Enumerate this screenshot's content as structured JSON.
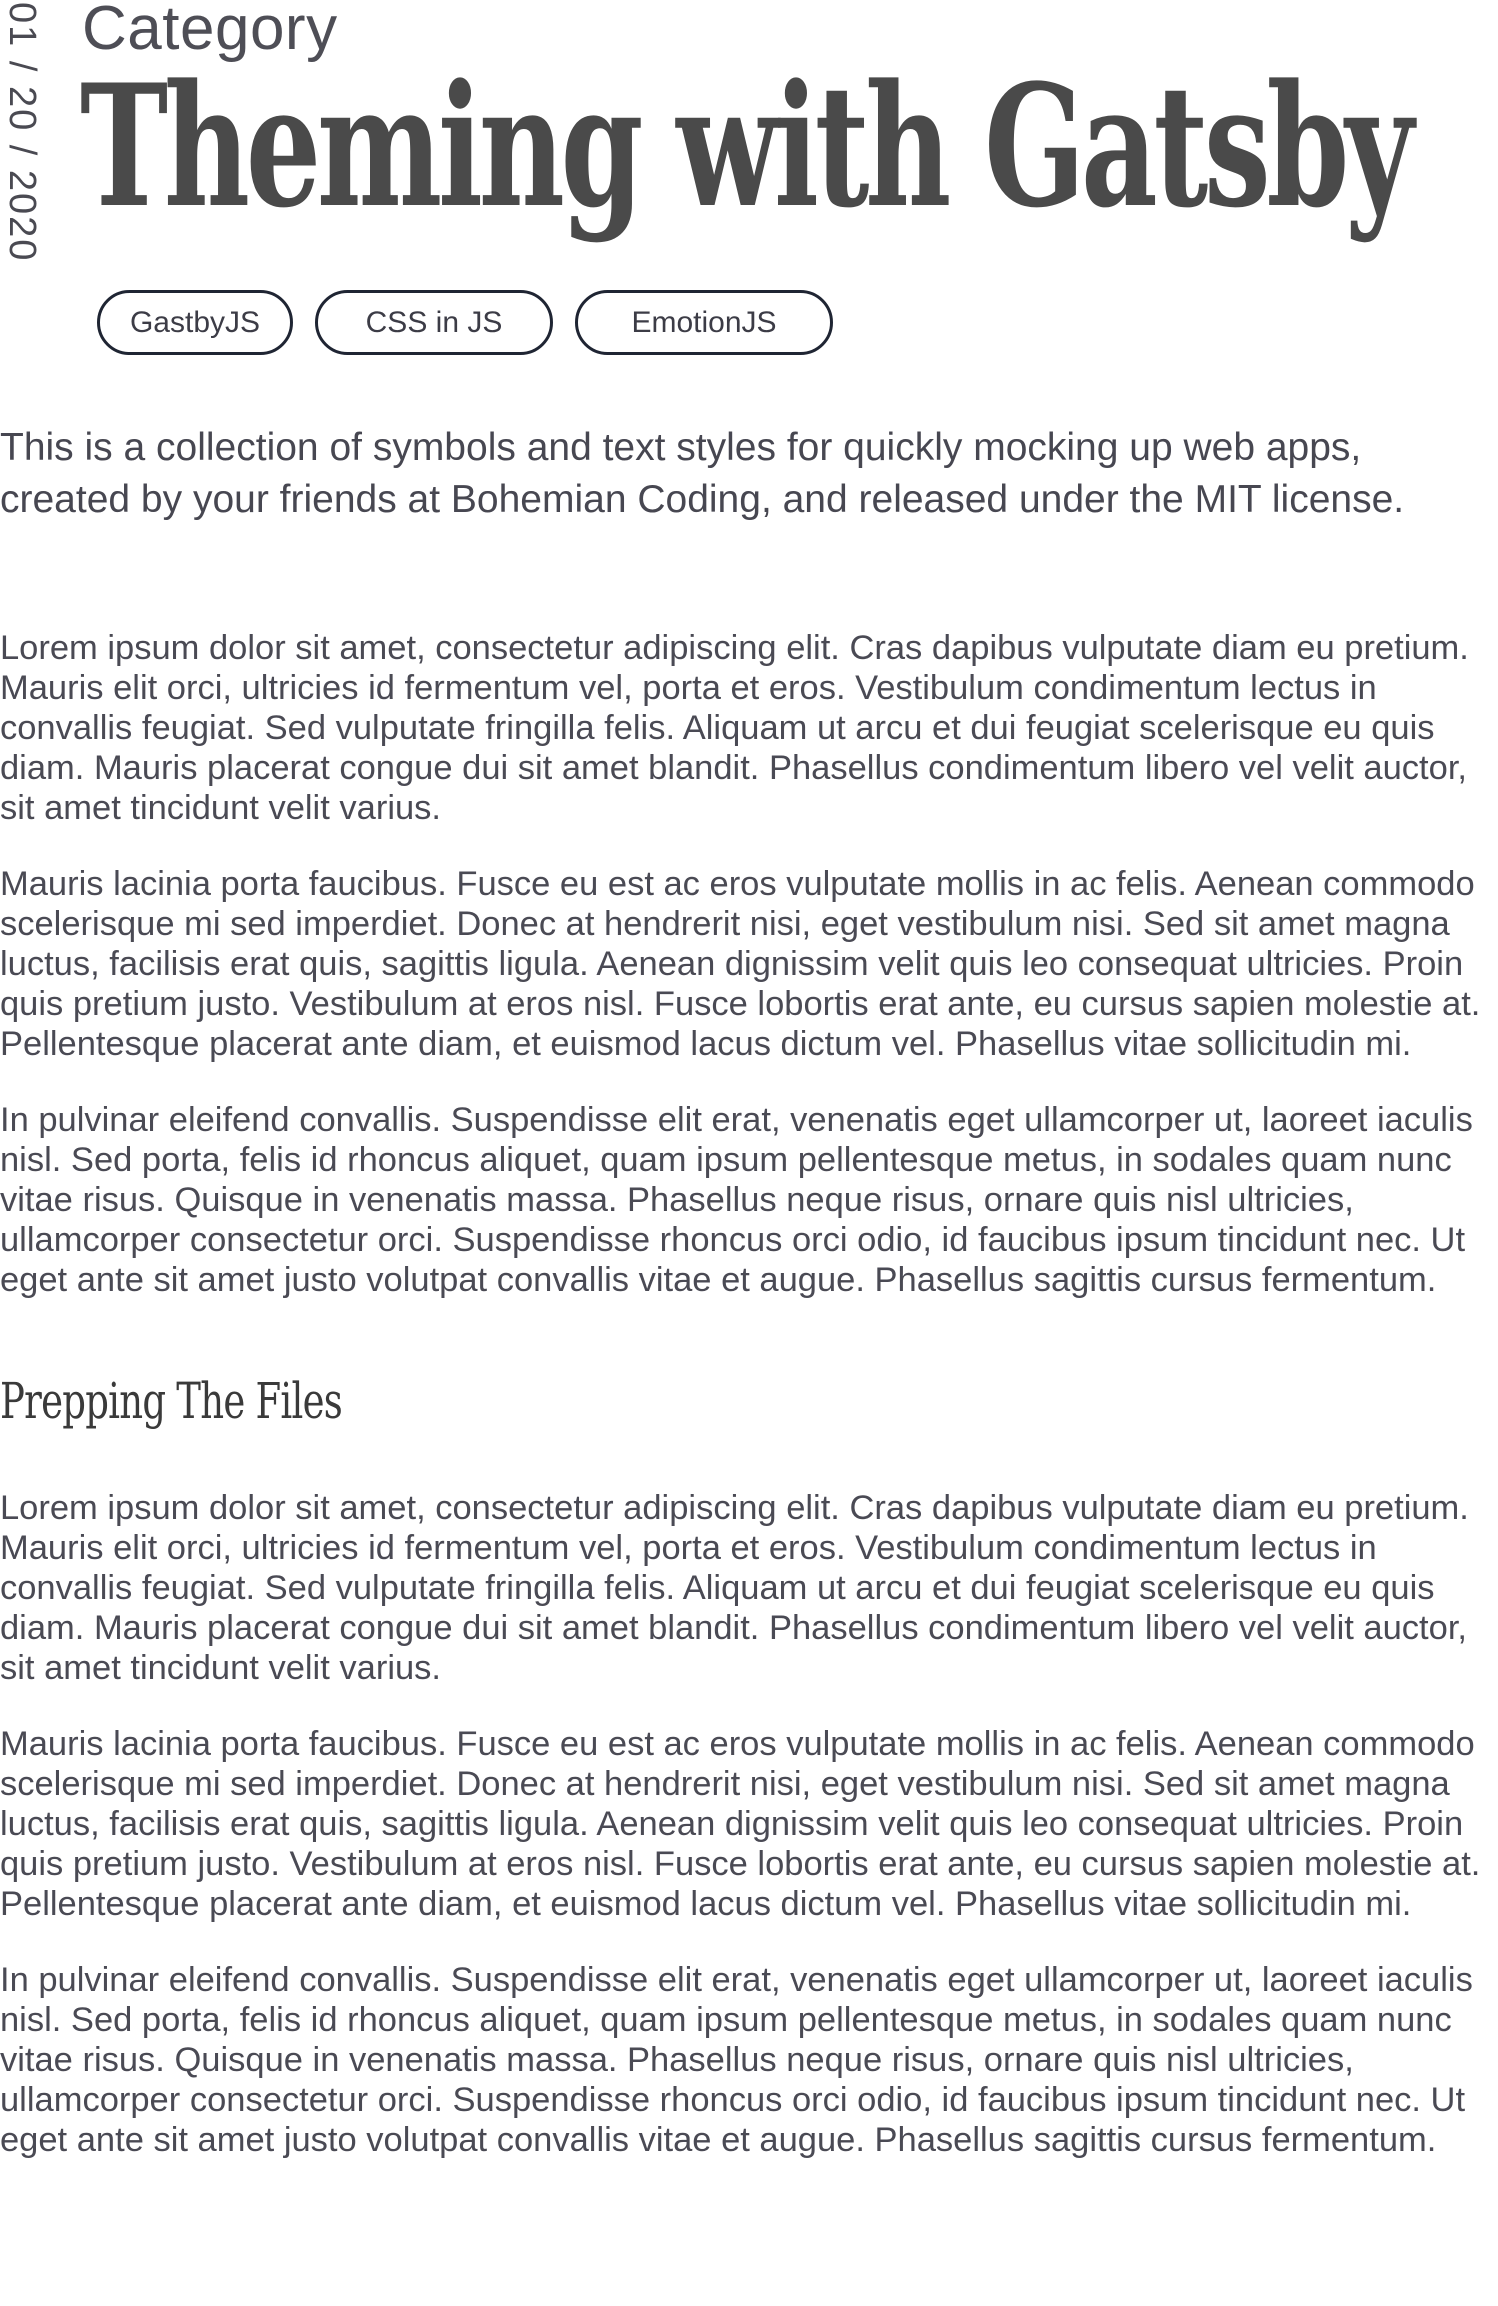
{
  "post": {
    "date": "01 / 20  / 2020",
    "category": "Category",
    "title": "Theming with Gatsby",
    "tags": [
      "GastbyJS",
      "CSS in JS",
      "EmotionJS"
    ],
    "lead": "This is a collection of symbols and text styles for quickly mocking up web apps, created by your friends at Bohemian Coding, and released under the MIT license."
  },
  "content": {
    "intro_paragraphs": [
      "Lorem ipsum dolor sit amet, consectetur adipiscing elit. Cras dapibus vulputate diam eu pretium. Mauris elit orci, ultricies id fermentum vel, porta et eros. Vestibulum condimentum lectus in convallis feugiat. Sed vulputate fringilla felis. Aliquam ut arcu et dui feugiat scelerisque eu quis diam. Mauris placerat congue dui sit amet blandit. Phasellus condimentum libero vel velit auctor, sit amet tincidunt velit varius.",
      "Mauris lacinia porta faucibus. Fusce eu est ac eros vulputate mollis in ac felis. Aenean commodo scelerisque mi sed imperdiet. Donec at hendrerit nisi, eget vestibulum nisi. Sed sit amet magna luctus, facilisis erat quis, sagittis ligula. Aenean dignissim velit quis leo consequat ultricies. Proin quis pretium justo. Vestibulum at eros nisl. Fusce lobortis erat ante, eu cursus sapien molestie at. Pellentesque placerat ante diam, et euismod lacus dictum vel. Phasellus vitae sollicitudin mi.",
      "In pulvinar eleifend convallis. Suspendisse elit erat, venenatis eget ullamcorper ut, laoreet iaculis nisl. Sed porta, felis id rhoncus aliquet, quam ipsum pellentesque metus, in sodales quam nunc vitae risus. Quisque in venenatis massa. Phasellus neque risus, ornare quis nisl ultricies, ullamcorper consectetur orci. Suspendisse rhoncus orci odio, id faucibus ipsum tincidunt nec. Ut eget ante sit amet justo volutpat convallis vitae et augue. Phasellus sagittis cursus fermentum."
    ],
    "section_heading": "Prepping The Files",
    "section_paragraphs": [
      "Lorem ipsum dolor sit amet, consectetur adipiscing elit. Cras dapibus vulputate diam eu pretium. Mauris elit orci, ultricies id fermentum vel, porta et eros. Vestibulum condimentum lectus in convallis feugiat. Sed vulputate fringilla felis. Aliquam ut arcu et dui feugiat scelerisque eu quis diam. Mauris placerat congue dui sit amet blandit. Phasellus condimentum libero vel velit auctor, sit amet tincidunt velit varius.",
      "Mauris lacinia porta faucibus. Fusce eu est ac eros vulputate mollis in ac felis. Aenean commodo scelerisque mi sed imperdiet. Donec at hendrerit nisi, eget vestibulum nisi. Sed sit amet magna luctus, facilisis erat quis, sagittis ligula. Aenean dignissim velit quis leo consequat ultricies. Proin quis pretium justo. Vestibulum at eros nisl. Fusce lobortis erat ante, eu cursus sapien molestie at. Pellentesque placerat ante diam, et euismod lacus dictum vel. Phasellus vitae sollicitudin mi.",
      "In pulvinar eleifend convallis. Suspendisse elit erat, venenatis eget ullamcorper ut, laoreet iaculis nisl. Sed porta, felis id rhoncus aliquet, quam ipsum pellentesque metus, in sodales quam nunc vitae risus. Quisque in venenatis massa. Phasellus neque risus, ornare quis nisl ultricies, ullamcorper consectetur orci. Suspendisse rhoncus orci odio, id faucibus ipsum tincidunt nec. Ut eget ante sit amet justo volutpat convallis vitae et augue. Phasellus sagittis cursus fermentum."
    ]
  },
  "colors": {
    "text": "#4a4a54",
    "title": "#4a4a4a",
    "tag_border": "#1f2533",
    "background": "#ffffff"
  }
}
